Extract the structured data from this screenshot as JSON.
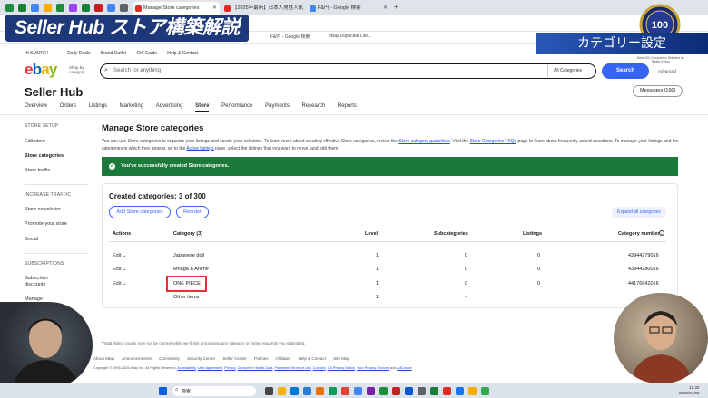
{
  "browser": {
    "tabs": [
      {
        "label": "Manage Store categories",
        "active": true
      },
      {
        "label": "【2025年最新】日本人男性人気",
        "active": false
      },
      {
        "label": "F&円 - Google 検索",
        "active": false
      }
    ],
    "bookmarks": [
      "F&円 - Google 検索",
      "eBay Duplicate List..."
    ]
  },
  "overlay": {
    "title": "Seller Hub ストア構築解説",
    "topic": "カテゴリー設定",
    "award_number": "100",
    "award_caption": "Best 100 Companies Selected by Nikkei Keiryu"
  },
  "ebay": {
    "topnav": [
      "Hi SMORE!",
      "Daily Deals",
      "Brand Outlet",
      "Gift Cards",
      "Help & Contact"
    ],
    "logo_letters": [
      "e",
      "b",
      "a",
      "y"
    ],
    "logo_colors": [
      "#e53238",
      "#0064d2",
      "#f5af02",
      "#86b817"
    ],
    "shop_by": "Shop by category",
    "search_placeholder": "Search for anything",
    "search_category": "All Categories",
    "search_button": "Search",
    "advanced": "Advanced",
    "hub_title": "Seller Hub",
    "messages": "Messages (190)",
    "main_nav": [
      "Overview",
      "Orders",
      "Listings",
      "Marketing",
      "Advertising",
      "Store",
      "Performance",
      "Payments",
      "Research",
      "Reports"
    ],
    "active_nav": "Store"
  },
  "sidebar": {
    "store_setup_heading": "STORE SETUP",
    "store_setup_items": [
      "Edit store",
      "Store categories",
      "Store traffic"
    ],
    "active_item": "Store categories",
    "increase_traffic_heading": "INCREASE TRAFFIC",
    "increase_traffic_items": [
      "Store newsletter",
      "Promote your store",
      "Social"
    ],
    "subscriptions_heading": "SUBSCRIPTIONS",
    "subscriptions_items": [
      "Subscriber discounts",
      "Manage"
    ]
  },
  "page": {
    "title": "Manage Store categories",
    "desc_1": "You can use Store categories to organize your listings and curate your selection. To learn more about creating effective Store categories, review the ",
    "desc_link_1": "Store category guidelines",
    "desc_2": ". Visit the ",
    "desc_link_2": "Store Categories FAQs",
    "desc_3": " page to learn about frequently asked questions. To manage your listings and the categories in which they appear, go to the ",
    "desc_link_3": "Active listings",
    "desc_4": " page, select the listings that you want to move, and edit them.",
    "success": "You've successfully created Store categories.",
    "created": "Created categories: 3 of 300",
    "add_button": "Add Store categories",
    "reorder_button": "Reorder",
    "expand_button": "Expand all categories"
  },
  "table": {
    "headers": [
      "Actions",
      "Category (3)",
      "Level",
      "Subcategories",
      "Listings",
      "Category number"
    ],
    "rows": [
      {
        "action": "Edit",
        "category": "Japanese doll",
        "level": "1",
        "subcategories": "0",
        "listings": "0",
        "number": "43944279016"
      },
      {
        "action": "Edit",
        "category": "Mnaga & Anime",
        "level": "1",
        "subcategories": "0",
        "listings": "0",
        "number": "43944280016"
      },
      {
        "action": "Edit",
        "category": "ONE PIECE",
        "level": "1",
        "subcategories": "0",
        "listings": "0",
        "number": "44176642016"
      },
      {
        "action": "",
        "category": "Other items",
        "level": "1",
        "subcategories": "-",
        "listings": "",
        "number": "1"
      }
    ]
  },
  "footer": {
    "note": "*Total listing counts may not be current while we finish processing any category or listing requests you submitted.",
    "links": [
      "About eBay",
      "Announcements",
      "Community",
      "Security Center",
      "Seller Center",
      "Policies",
      "Affiliates",
      "Help & Contact",
      "Site Map"
    ],
    "copyright": "Copyright © 1995-2025 eBay Inc. All Rights Reserved. ",
    "legal_links": [
      "Accessibility",
      "User Agreement",
      "Privacy",
      "Consumer Health Data",
      "Payments Terms of Use",
      "Cookies",
      "CA Privacy Notice",
      "Your Privacy Choices",
      "AdChoice"
    ]
  },
  "taskbar": {
    "search": "検索",
    "time": "12:32",
    "date": "2025/04/06"
  }
}
